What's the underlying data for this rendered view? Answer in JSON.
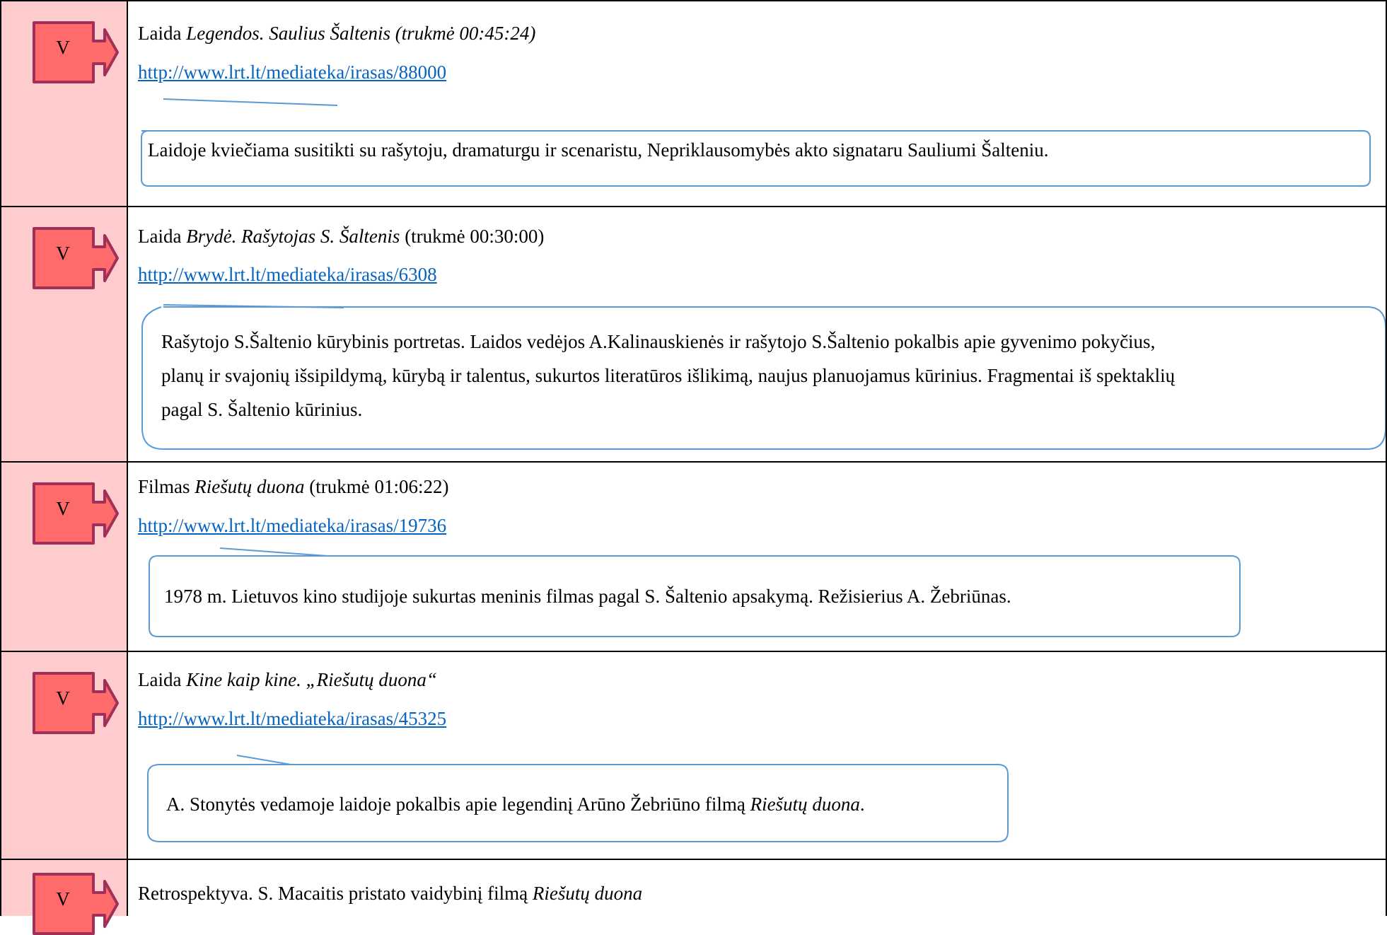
{
  "colors": {
    "left_column_bg": "#fecccc",
    "badge_fill": "#ff6b6b",
    "badge_stroke": "#a0305a",
    "link": "#0563c1",
    "callout_stroke": "#5b9bd5"
  },
  "badge_icon": "right-turn-arrow-icon",
  "entries": [
    {
      "badge": "V",
      "line1": {
        "prefix": "Laida ",
        "title": "Legendos. Saulius Šaltenis (trukmė 00:45:24)",
        "suffix": ""
      },
      "link": "http://www.lrt.lt/mediateka/irasas/88000",
      "callout": "Laidoje kviečiama susitikti su rašytoju, dramaturgu ir scenaristu, Nepriklausomybės akto signataru Sauliumi Šalteniu."
    },
    {
      "badge": "V",
      "line1": {
        "prefix": "Laida ",
        "title": "Brydė. Rašytojas S. Šaltenis",
        "suffix": " (trukmė 00:30:00)"
      },
      "link": "http://www.lrt.lt/mediateka/irasas/6308",
      "callout_lines": [
        "Rašytojo S.Šaltenio kūrybinis portretas. Laidos vedėjos A.Kalinauskienės ir rašytojo S.Šaltenio pokalbis apie gyvenimo pokyčius,",
        "planų ir svajonių išsipildymą, kūrybą ir talentus, sukurtos literatūros išlikimą, naujus planuojamus kūrinius. Fragmentai iš spektaklių",
        "pagal S. Šaltenio kūrinius."
      ]
    },
    {
      "badge": "V",
      "line1": {
        "prefix": "Filmas ",
        "title": "Riešutų duona",
        "suffix": " (trukmė 01:06:22)"
      },
      "link": "http://www.lrt.lt/mediateka/irasas/19736",
      "callout": "1978 m. Lietuvos kino studijoje sukurtas meninis filmas pagal S. Šaltenio apsakymą. Režisierius A. Žebriūnas."
    },
    {
      "badge": "V",
      "line1": {
        "prefix": "Laida ",
        "title": "Kine kaip kine. „Riešutų duona“",
        "suffix": ""
      },
      "link": "http://www.lrt.lt/mediateka/irasas/45325",
      "callout": {
        "prefix": "A. Stonytės vedamoje laidoje pokalbis apie legendinį Arūno Žebriūno filmą ",
        "title": "Riešutų duona",
        "suffix": "."
      }
    },
    {
      "badge": "V",
      "line1": {
        "prefix": "Retrospektyva. S. Macaitis pristato vaidybinį filmą ",
        "title": "Riešutų duona",
        "suffix": ""
      }
    }
  ]
}
